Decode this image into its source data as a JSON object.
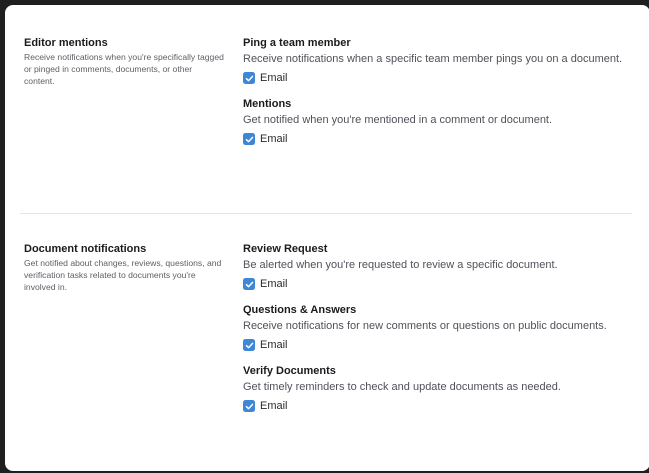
{
  "sections": [
    {
      "title": "Editor mentions",
      "description": "Receive notifications when you're specifically tagged or pinged in comments, documents, or other content.",
      "items": [
        {
          "title": "Ping a team member",
          "description": "Receive notifications when a specific team member pings you on a document.",
          "option_label": "Email",
          "checked": true
        },
        {
          "title": "Mentions",
          "description": "Get notified when you're mentioned in a comment or document.",
          "option_label": "Email",
          "checked": true
        }
      ]
    },
    {
      "title": "Document notifications",
      "description": "Get notified about changes, reviews, questions, and verification tasks related to documents you're involved in.",
      "items": [
        {
          "title": "Review Request",
          "description": "Be alerted when you're requested to review a specific document.",
          "option_label": "Email",
          "checked": true
        },
        {
          "title": "Questions & Answers",
          "description": "Receive notifications for new comments or questions on public documents.",
          "option_label": "Email",
          "checked": true
        },
        {
          "title": "Verify Documents",
          "description": "Get timely reminders to check and update documents as needed.",
          "option_label": "Email",
          "checked": true
        }
      ]
    }
  ],
  "colors": {
    "checkbox": "#3e86d6",
    "divider": "#e4e5e8"
  },
  "icons": {
    "checkbox": "checkmark-icon"
  }
}
